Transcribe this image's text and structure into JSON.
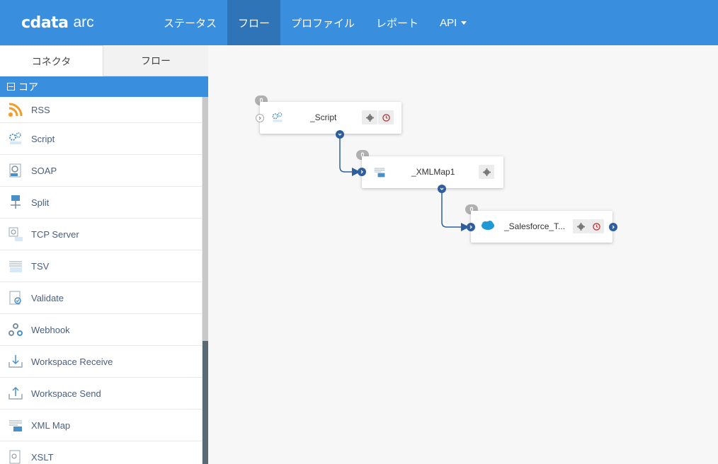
{
  "brand": {
    "mark": "cdata",
    "name": "arc"
  },
  "nav": {
    "items": [
      {
        "label": "ステータス"
      },
      {
        "label": "フロー"
      },
      {
        "label": "プロファイル"
      },
      {
        "label": "レポート"
      },
      {
        "label": "API"
      }
    ],
    "active": "フロー"
  },
  "sidebar": {
    "tabs": [
      {
        "label": "コネクタ"
      },
      {
        "label": "フロー"
      }
    ],
    "section": {
      "label": "コア"
    },
    "items": [
      {
        "label": "RSS",
        "icon": "rss-icon"
      },
      {
        "label": "Script",
        "icon": "script-icon"
      },
      {
        "label": "SOAP",
        "icon": "soap-icon"
      },
      {
        "label": "Split",
        "icon": "split-icon"
      },
      {
        "label": "TCP Server",
        "icon": "tcp-server-icon"
      },
      {
        "label": "TSV",
        "icon": "tsv-icon"
      },
      {
        "label": "Validate",
        "icon": "validate-icon"
      },
      {
        "label": "Webhook",
        "icon": "webhook-icon"
      },
      {
        "label": "Workspace Receive",
        "icon": "workspace-receive-icon"
      },
      {
        "label": "Workspace Send",
        "icon": "workspace-send-icon"
      },
      {
        "label": "XML Map",
        "icon": "xml-map-icon"
      },
      {
        "label": "XSLT",
        "icon": "xslt-icon"
      }
    ]
  },
  "flow": {
    "nodes": [
      {
        "label": "_Script",
        "count": "0",
        "icon": "script-icon"
      },
      {
        "label": "_XMLMap1",
        "count": "0",
        "icon": "xml-map-icon"
      },
      {
        "label": "_Salesforce_T...",
        "count": "0",
        "icon": "salesforce-icon"
      }
    ]
  },
  "colors": {
    "header": "#3a8ede",
    "nav_active": "#2f74b6",
    "port": "#2f5e9e",
    "wire": "#2f5e9e",
    "rss": "#f39c2b"
  }
}
